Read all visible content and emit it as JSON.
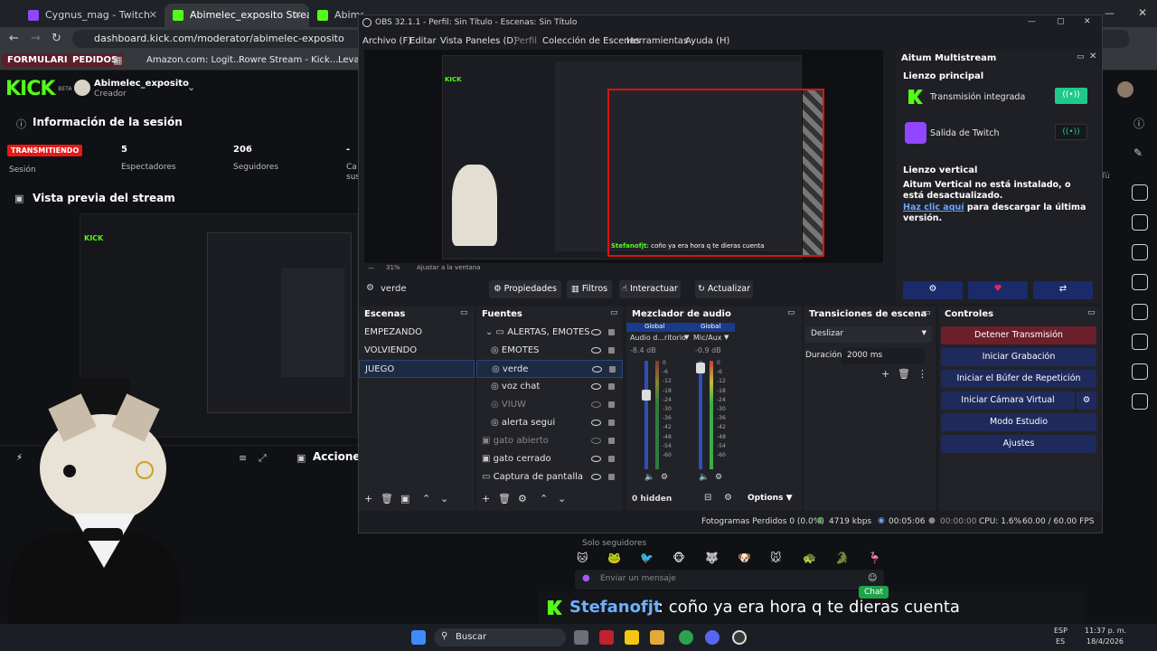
{
  "browser": {
    "tabs": [
      {
        "title": "Cygnus_mag - Twitch",
        "color": "#9146ff"
      },
      {
        "title": "Abimelec_exposito Stream",
        "color": "#53fc18"
      },
      {
        "title": "Abimelec_exposito Stream - W",
        "color": "#53fc18"
      }
    ],
    "url": "dashboard.kick.com/moderator/abimelec-exposito",
    "bookmarks": [
      "FORMULARIOS",
      "PEDIDOS",
      "Amazon.com: Logit...",
      "Rowre Stream - Kick...",
      "Levar"
    ]
  },
  "kick": {
    "logo": "KICK",
    "beta": "BETA",
    "user_name": "Abimelec_exposito",
    "user_role": "Creador",
    "session_title": "Información de la sesión",
    "live_badge": "TRANSMITIENDO",
    "session_label": "Sesión",
    "viewers_value": "5",
    "viewers_label": "Espectadores",
    "followers_value": "206",
    "followers_label": "Seguidores",
    "extra_value": "-",
    "extra_label": "Ca",
    "extra_label2": "sus",
    "preview_title": "Vista previa del stream",
    "actions_title": "Acciones",
    "followers_only": "Solo seguidores",
    "chat_placeholder": "Enviar un mensaje",
    "tu": "Tú"
  },
  "obs": {
    "title": "OBS 32.1.1 - Perfil: Sin Título - Escenas: Sin Título",
    "menu": [
      "Archivo (F)",
      "Editar",
      "Vista",
      "Paneles (D)",
      "Perfil",
      "Colección de Escenas",
      "Herramientas",
      "Ayuda (H)"
    ],
    "preview_zoom": "31%",
    "preview_fit": "Ajustar a la ventana",
    "preview_chat_user": "Stefanofjt",
    "preview_chat_msg": "coño ya era hora q te dieras cuenta",
    "source_toolbar": {
      "selected": "verde",
      "properties": "Propiedades",
      "filters": "Filtros",
      "interact": "Interactuar",
      "refresh": "Actualizar"
    },
    "scenes": {
      "title": "Escenas",
      "items": [
        "EMPEZANDO",
        "VOLVIENDO",
        "JUEGO"
      ],
      "selected": "JUEGO"
    },
    "sources": {
      "title": "Fuentes",
      "items": [
        "ALERTAS, EMOTES",
        "EMOTES",
        "verde",
        "voz chat",
        "VIUW",
        "alerta segui",
        "gato abierto",
        "gato cerrado",
        "Captura de pantalla"
      ]
    },
    "mixer": {
      "title": "Mezclador de audio",
      "global": "Global",
      "ch1_name": "Audio d...ritorio",
      "ch1_db": "-8.4 dB",
      "ch2_name": "Mic/Aux",
      "ch2_db": "-0.9 dB",
      "scale": [
        "0",
        "-6",
        "-12",
        "-18",
        "-24",
        "-30",
        "-36",
        "-42",
        "-48",
        "-54",
        "-60"
      ],
      "hidden": "0 hidden",
      "options": "Options"
    },
    "transitions": {
      "title": "Transiciones de escena",
      "type": "Deslizar",
      "duration_label": "Duración",
      "duration_value": "2000 ms"
    },
    "controls": {
      "title": "Controles",
      "buttons": [
        "Detener Transmisión",
        "Iniciar Grabación",
        "Iniciar el Búfer de Repetición",
        "Iniciar Cámara Virtual",
        "Modo Estudio",
        "Ajustes"
      ]
    },
    "aitum": {
      "title": "Aitum Multistream",
      "main_canvas": "Lienzo principal",
      "integrated": "Transmisión integrada",
      "twitch_out": "Salida de Twitch",
      "vertical_title": "Lienzo vertical",
      "vertical_msg": "Aitum Vertical no está instalado, o está desactualizado.",
      "link_text": "Haz clic aquí",
      "link_rest": " para descargar la última versión."
    },
    "status": {
      "dropped": "Fotogramas Perdidos 0 (0.0%)",
      "bitrate": "4719 kbps",
      "stream_time": "00:05:06",
      "rec_time": "00:00:00",
      "cpu": "CPU: 1.6%",
      "fps": "60.00 / 60.00 FPS"
    }
  },
  "chat_overlay": {
    "user": "Stefanofjt",
    "message": ": coño ya era hora q te dieras cuenta",
    "chat_tag": "Chat"
  },
  "taskbar": {
    "search": "Buscar",
    "lang1": "ESP",
    "lang2": "ES",
    "time": "11:37 p. m.",
    "date": "18/4/2026"
  },
  "colors": {
    "kick_green": "#53fc18",
    "twitch_purple": "#9146ff",
    "obs_bg": "#1c1d22",
    "stop_red": "#6b1f2a",
    "ctrl_blue": "#1f2a5c",
    "live_red": "#e91916"
  }
}
